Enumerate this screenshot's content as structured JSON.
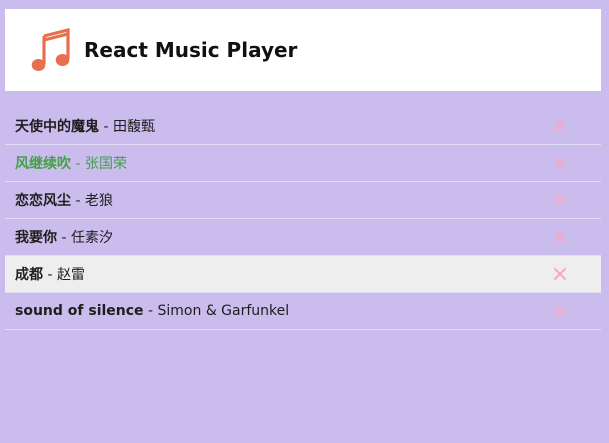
{
  "app": {
    "title": "React Music Player",
    "logo_icon": "music-note-icon",
    "accent_color": "#e76e4e",
    "background_color": "#cbbcee",
    "active_track_color": "#43a047",
    "delete_icon_color": "#f7a8c6"
  },
  "playlist": {
    "separator": "-",
    "delete_icon": "close-icon",
    "tracks": [
      {
        "title": "天使中的魔鬼",
        "artist": "田馥甄",
        "active": false,
        "hover": false
      },
      {
        "title": "风继续吹",
        "artist": "张国荣",
        "active": true,
        "hover": false
      },
      {
        "title": "恋恋风尘",
        "artist": "老狼",
        "active": false,
        "hover": false
      },
      {
        "title": "我要你",
        "artist": "任素汐",
        "active": false,
        "hover": false
      },
      {
        "title": "成都",
        "artist": "赵雷",
        "active": false,
        "hover": true
      },
      {
        "title": "sound of silence",
        "artist": "Simon & Garfunkel",
        "active": false,
        "hover": false
      }
    ]
  }
}
